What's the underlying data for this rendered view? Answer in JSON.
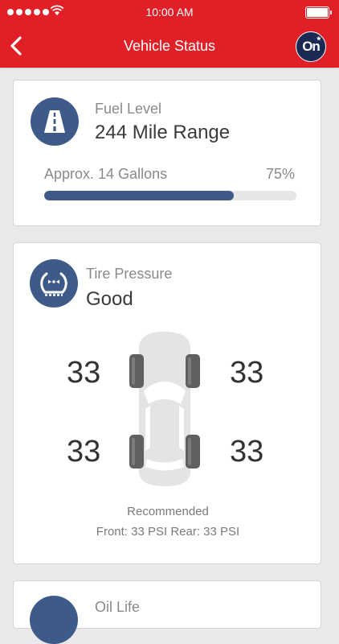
{
  "status_bar": {
    "time": "10:00 AM"
  },
  "nav": {
    "title": "Vehicle Status",
    "logo": "On"
  },
  "fuel": {
    "label": "Fuel Level",
    "range": "244 Mile Range",
    "approx": "Approx. 14 Gallons",
    "percent_text": "75%",
    "percent": 0.75,
    "icon": "road-icon"
  },
  "tire": {
    "label": "Tire Pressure",
    "status": "Good",
    "front_left": "33",
    "front_right": "33",
    "rear_left": "33",
    "rear_right": "33",
    "recommended_label": "Recommended",
    "recommended_values": "Front: 33 PSI Rear: 33 PSI",
    "icon": "tire-pressure-icon"
  },
  "oil": {
    "label": "Oil Life"
  },
  "colors": {
    "brand_red": "#e11f26",
    "accent_blue": "#3d5a89",
    "onstar_navy": "#1a2a52"
  }
}
